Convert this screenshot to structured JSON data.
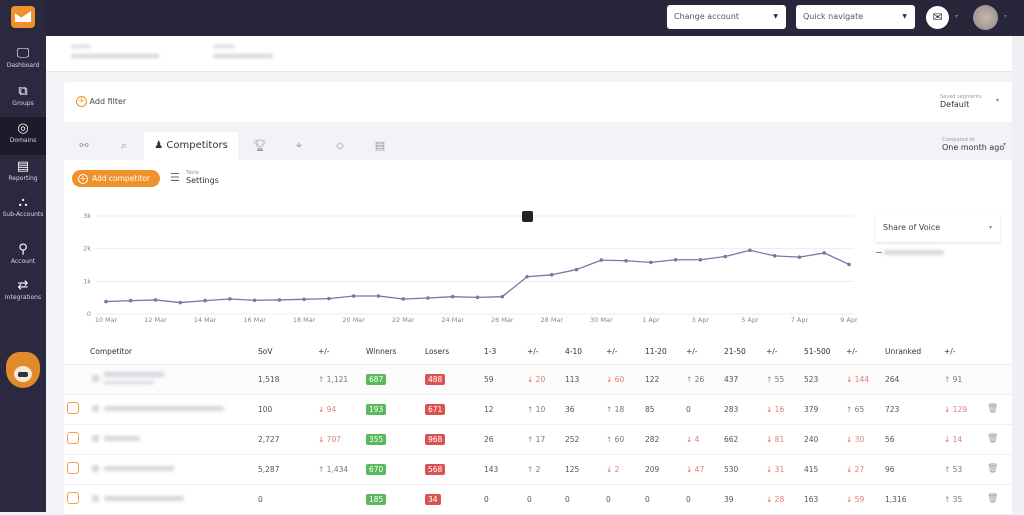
{
  "sidebar": {
    "items": [
      {
        "label": "Dashboard",
        "icon": "monitor-icon",
        "glyph": "🖵"
      },
      {
        "label": "Groups",
        "icon": "sitemap-icon",
        "glyph": "⧉"
      },
      {
        "label": "Domains",
        "icon": "globe-icon",
        "glyph": "◎",
        "active": true
      },
      {
        "label": "Reporting",
        "icon": "report-icon",
        "glyph": "▤"
      },
      {
        "label": "Sub-Accounts",
        "icon": "nodes-icon",
        "glyph": "⛬"
      },
      {
        "label": "Account",
        "icon": "account-icon",
        "glyph": "⚲"
      },
      {
        "label": "Integrations",
        "icon": "integrations-icon",
        "glyph": "⇄"
      }
    ]
  },
  "topbar": {
    "change_account": "Change account",
    "quick_navigate": "Quick navigate"
  },
  "filters": {
    "add_filter": "Add filter",
    "saved_segments_label": "Saved segments",
    "saved_segments_value": "Default"
  },
  "tabs": {
    "active": "Competitors",
    "compared_label": "Compared to",
    "compared_value": "One month ago"
  },
  "toolbar": {
    "add_competitor": "Add competitor",
    "table_label": "Table",
    "settings": "Settings"
  },
  "legend": {
    "metric": "Share of Voice"
  },
  "chart_data": {
    "type": "line",
    "y_ticks": [
      "0",
      "1k",
      "2k",
      "3k"
    ],
    "ylim": [
      0,
      3000
    ],
    "x_ticks": [
      "10 Mar",
      "12 Mar",
      "14 Mar",
      "16 Mar",
      "18 Mar",
      "20 Mar",
      "22 Mar",
      "24 Mar",
      "26 Mar",
      "28 Mar",
      "30 Mar",
      "1 Apr",
      "3 Apr",
      "5 Apr",
      "7 Apr",
      "9 Apr"
    ],
    "x": [
      "10 Mar",
      "11 Mar",
      "12 Mar",
      "13 Mar",
      "14 Mar",
      "15 Mar",
      "16 Mar",
      "17 Mar",
      "18 Mar",
      "19 Mar",
      "20 Mar",
      "21 Mar",
      "22 Mar",
      "23 Mar",
      "24 Mar",
      "25 Mar",
      "26 Mar",
      "27 Mar",
      "28 Mar",
      "29 Mar",
      "30 Mar",
      "31 Mar",
      "1 Apr",
      "2 Apr",
      "3 Apr",
      "4 Apr",
      "5 Apr",
      "6 Apr",
      "7 Apr",
      "8 Apr",
      "9 Apr"
    ],
    "values": [
      380,
      410,
      430,
      350,
      410,
      460,
      420,
      430,
      450,
      470,
      550,
      550,
      460,
      490,
      530,
      510,
      530,
      1140,
      1200,
      1360,
      1650,
      1630,
      1580,
      1660,
      1660,
      1760,
      1950,
      1780,
      1740,
      1870,
      1518
    ],
    "grid": true,
    "color": "#7b76a6"
  },
  "table": {
    "headers": [
      "Competitor",
      "SoV",
      "+/-",
      "Winners",
      "Losers",
      "1-3",
      "+/-",
      "4-10",
      "+/-",
      "11-20",
      "+/-",
      "21-50",
      "+/-",
      "51-500",
      "+/-",
      "Unranked",
      "+/-"
    ],
    "rows": [
      {
        "checkbox": false,
        "cells": [
          "1,518",
          [
            "up",
            "1,121"
          ],
          "687",
          "488",
          "59",
          [
            "dn",
            "20"
          ],
          "113",
          [
            "dn",
            "60"
          ],
          "122",
          [
            "up",
            "26"
          ],
          "437",
          [
            "up",
            "55"
          ],
          "523",
          [
            "dn",
            "144"
          ],
          "264",
          [
            "up",
            "91"
          ]
        ]
      },
      {
        "checkbox": true,
        "cells": [
          "100",
          [
            "dn",
            "94"
          ],
          "193",
          "671",
          "12",
          [
            "up",
            "10"
          ],
          "36",
          [
            "up",
            "18"
          ],
          "85",
          "0",
          "283",
          [
            "dn",
            "16"
          ],
          "379",
          [
            "up",
            "65"
          ],
          "723",
          [
            "dn",
            "129"
          ]
        ]
      },
      {
        "checkbox": true,
        "cells": [
          "2,727",
          [
            "dn",
            "707"
          ],
          "355",
          "968",
          "26",
          [
            "up",
            "17"
          ],
          "252",
          [
            "up",
            "60"
          ],
          "282",
          [
            "dn",
            "4"
          ],
          "662",
          [
            "dn",
            "81"
          ],
          "240",
          [
            "dn",
            "30"
          ],
          "56",
          [
            "dn",
            "14"
          ]
        ]
      },
      {
        "checkbox": true,
        "cells": [
          "5,287",
          [
            "up",
            "1,434"
          ],
          "670",
          "568",
          "143",
          [
            "up",
            "2"
          ],
          "125",
          [
            "dn",
            "2"
          ],
          "209",
          [
            "dn",
            "47"
          ],
          "530",
          [
            "dn",
            "31"
          ],
          "415",
          [
            "dn",
            "27"
          ],
          "96",
          [
            "up",
            "53"
          ]
        ]
      },
      {
        "checkbox": true,
        "cells": [
          "0",
          "",
          "185",
          "34",
          "0",
          "0",
          "0",
          "0",
          "0",
          "0",
          "39",
          [
            "dn",
            "28"
          ],
          "163",
          [
            "dn",
            "59"
          ],
          "1,316",
          [
            "up",
            "35"
          ]
        ]
      }
    ]
  },
  "colors": {
    "sidebar": "#2b2940",
    "accent": "#f0922b",
    "winner": "#5cb85c",
    "loser": "#d9534f"
  }
}
